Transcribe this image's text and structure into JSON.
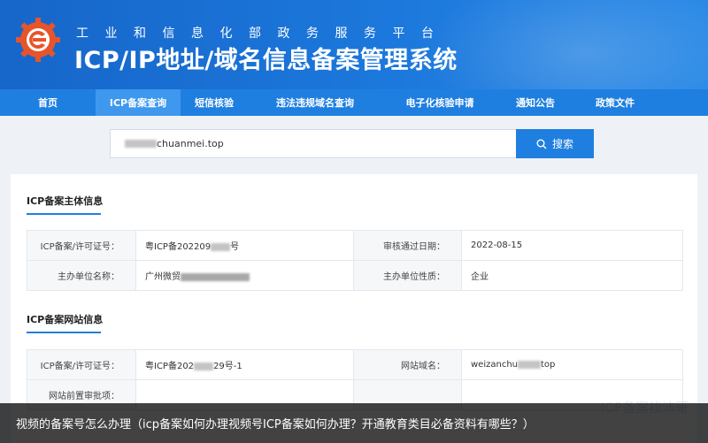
{
  "header": {
    "subtitle": "工业和信息化部政务服务平台",
    "title": "ICP/IP地址/域名信息备案管理系统"
  },
  "nav": {
    "items": [
      {
        "label": "首页"
      },
      {
        "label": "ICP备案查询"
      },
      {
        "label": "短信核验"
      },
      {
        "label": "违法违规域名查询"
      },
      {
        "label": "电子化核验申请"
      },
      {
        "label": "通知公告"
      },
      {
        "label": "政策文件"
      }
    ],
    "active_index": 1
  },
  "search": {
    "value_visible": "chuanmei.top",
    "button_label": "搜索"
  },
  "subject_section": {
    "title": "ICP备案主体信息",
    "rows": [
      {
        "label1": "ICP备案/许可证号：",
        "value1_prefix": "粤ICP备202209",
        "value1_suffix": "号",
        "label2": "审核通过日期：",
        "value2": "2022-08-15"
      },
      {
        "label1": "主办单位名称：",
        "value1_prefix": "广州微贸",
        "value1_suffix": "",
        "label2": "主办单位性质：",
        "value2": "企业"
      }
    ]
  },
  "website_section": {
    "title": "ICP备案网站信息",
    "rows": [
      {
        "label1": "ICP备案/许可证号：",
        "value1_prefix": "粤ICP备202",
        "value1_suffix": "29号-1",
        "label2": "网站域名：",
        "value2_prefix": "weizanchu",
        "value2_suffix": "top"
      },
      {
        "label1": "网站前置审批项：",
        "value1_prefix": "",
        "value1_suffix": "",
        "label2": "",
        "value2_prefix": "",
        "value2_suffix": ""
      }
    ]
  },
  "caption": {
    "text": "视频的备案号怎么办理（icp备案如何办理视频号ICP备案如何办理？开通教育类目必备资料有哪些？）"
  },
  "watermark": {
    "text": "ICP备案找沛哥"
  },
  "colors": {
    "header_blue": "#1c78dc",
    "nav_blue": "#1f7fe0",
    "nav_active": "#3e98ee",
    "accent_underline": "#1f7fe0"
  }
}
